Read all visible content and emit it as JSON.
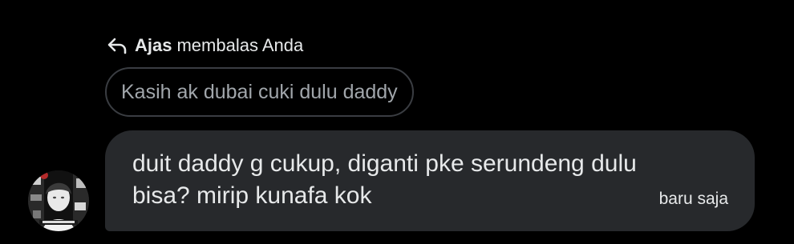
{
  "reply_header": {
    "icon": "reply-arrow-icon",
    "name": "Ajas",
    "text": "membalas Anda"
  },
  "quoted_message": {
    "text": "Kasih ak dubai cuki dulu daddy"
  },
  "message": {
    "line1": "duit daddy g cukup, diganti pke serundeng dulu",
    "line2": "bisa? mirip kunafa kok",
    "time": "baru saja"
  },
  "colors": {
    "background": "#000000",
    "bubble": "#27292c",
    "quoted_border": "#3a3d42",
    "quoted_text": "#a1a6ab",
    "text": "#e7e9ea"
  }
}
